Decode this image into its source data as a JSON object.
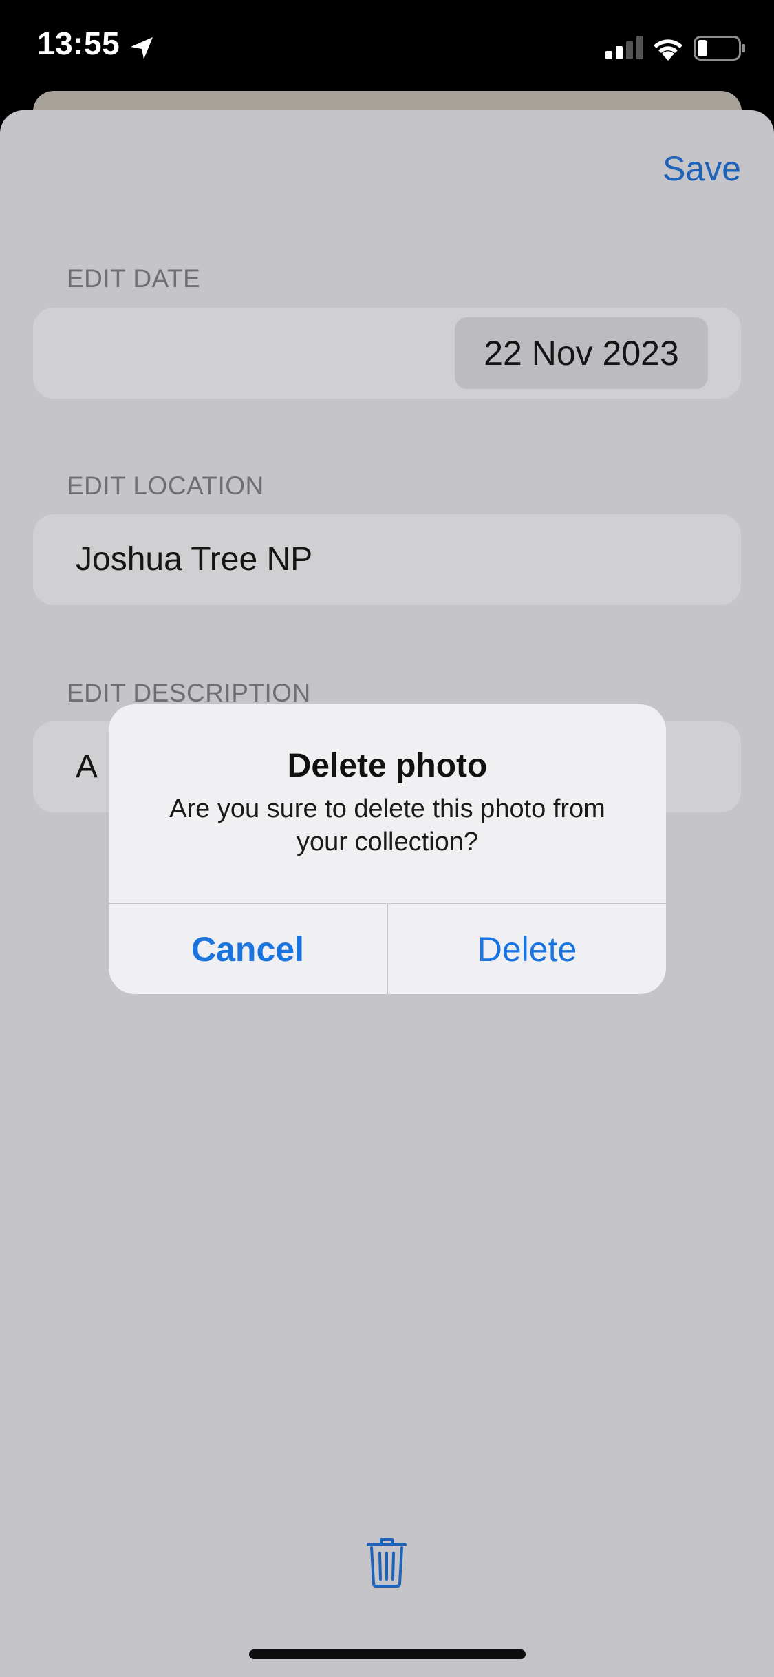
{
  "status_bar": {
    "time": "13:55",
    "icons": [
      "location-arrow-icon",
      "cellular-signal-icon",
      "wifi-icon",
      "battery-icon"
    ]
  },
  "nav": {
    "save_label": "Save"
  },
  "form": {
    "date": {
      "label": "EDIT DATE",
      "value": "22 Nov 2023"
    },
    "location": {
      "label": "EDIT LOCATION",
      "value": "Joshua Tree NP"
    },
    "description": {
      "label": "EDIT DESCRIPTION",
      "value_visible": "A"
    }
  },
  "alert": {
    "title": "Delete photo",
    "message": "Are you sure to delete this photo from your collection?",
    "cancel_label": "Cancel",
    "delete_label": "Delete"
  },
  "toolbar": {
    "trash_icon": "trash-icon"
  },
  "colors": {
    "accent": "#1f63b8",
    "alert_button": "#1a74e0",
    "sheet_background": "#c4c4c9",
    "field_background": "#d0d0d3"
  }
}
